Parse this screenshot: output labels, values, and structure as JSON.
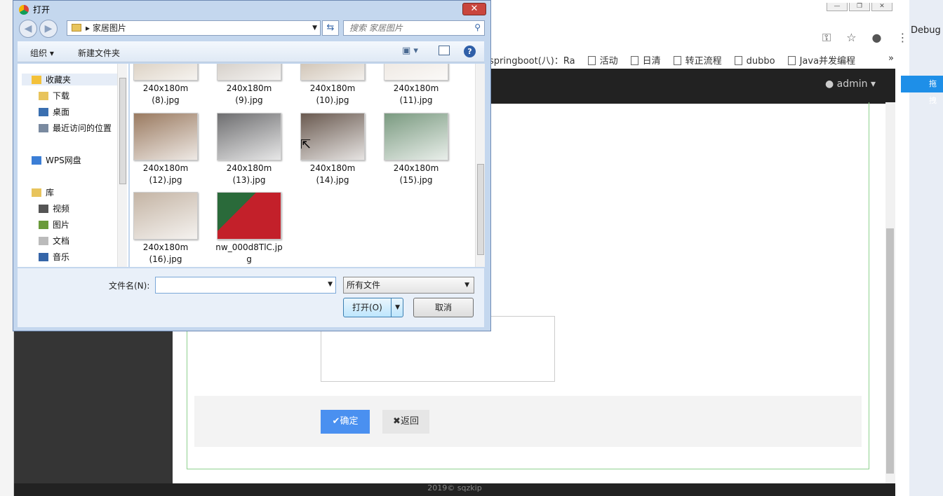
{
  "browser": {
    "bookmarks": [
      "springboot(八)：Ra",
      "活动",
      "日清",
      "转正流程",
      "dubbo",
      "Java并发编程"
    ],
    "more": "»",
    "admin_label": "admin",
    "debug_label": "Debug",
    "baidu_label": "拖拽"
  },
  "page": {
    "ok_label": "✔确定",
    "back_label": "✖返回",
    "footer": "2019© sqzkip"
  },
  "dialog": {
    "title": "打开",
    "close": "✕",
    "path": "家居图片",
    "search_placeholder": "搜索 家居图片",
    "toolbar": {
      "organize": "组织 ▾",
      "new_folder": "新建文件夹"
    },
    "nav": [
      {
        "label": "收藏夹",
        "icon": "star-icon"
      },
      {
        "label": "下载",
        "icon": "download-folder-icon"
      },
      {
        "label": "桌面",
        "icon": "desktop-icon"
      },
      {
        "label": "最近访问的位置",
        "icon": "recent-places-icon"
      },
      {
        "label": "WPS网盘",
        "icon": "cloud-icon"
      },
      {
        "label": "库",
        "icon": "library-icon"
      },
      {
        "label": "视频",
        "icon": "video-icon"
      },
      {
        "label": "图片",
        "icon": "pictures-icon"
      },
      {
        "label": "文档",
        "icon": "documents-icon"
      },
      {
        "label": "音乐",
        "icon": "music-icon"
      }
    ],
    "files": [
      {
        "line1": "240x180m",
        "line2": "(8).jpg"
      },
      {
        "line1": "240x180m",
        "line2": "(9).jpg"
      },
      {
        "line1": "240x180m",
        "line2": "(10).jpg"
      },
      {
        "line1": "240x180m",
        "line2": "(11).jpg"
      },
      {
        "line1": "240x180m",
        "line2": "(12).jpg"
      },
      {
        "line1": "240x180m",
        "line2": "(13).jpg"
      },
      {
        "line1": "240x180m",
        "line2": "(14).jpg"
      },
      {
        "line1": "240x180m",
        "line2": "(15).jpg"
      },
      {
        "line1": "240x180m",
        "line2": "(16).jpg"
      },
      {
        "line1": "nw_000d8TlC.jp",
        "line2": "g"
      }
    ],
    "filename_label": "文件名(N):",
    "filename_value": "",
    "filetype": "所有文件",
    "open_label": "打开(O)",
    "cancel_label": "取消"
  }
}
